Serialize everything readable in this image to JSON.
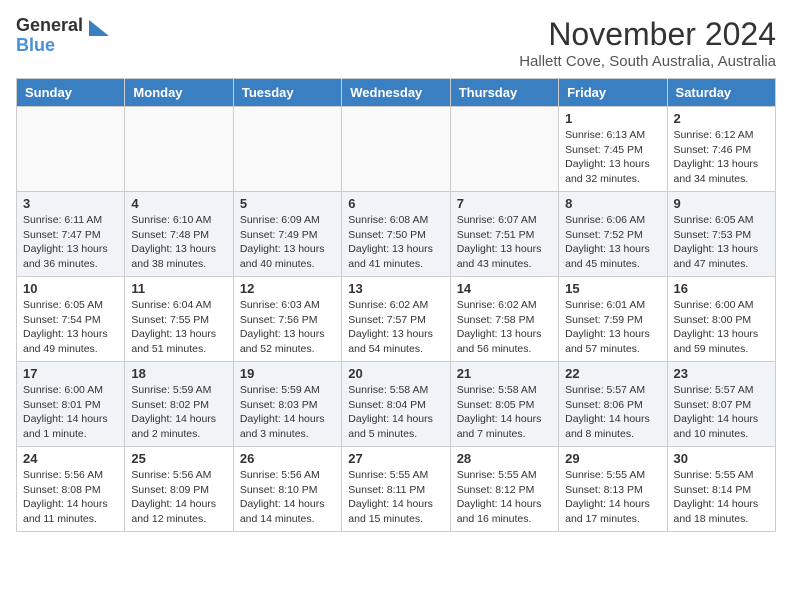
{
  "header": {
    "logo_general": "General",
    "logo_blue": "Blue",
    "month_title": "November 2024",
    "location": "Hallett Cove, South Australia, Australia"
  },
  "weekdays": [
    "Sunday",
    "Monday",
    "Tuesday",
    "Wednesday",
    "Thursday",
    "Friday",
    "Saturday"
  ],
  "weeks": [
    [
      {
        "day": "",
        "empty": true
      },
      {
        "day": "",
        "empty": true
      },
      {
        "day": "",
        "empty": true
      },
      {
        "day": "",
        "empty": true
      },
      {
        "day": "",
        "empty": true
      },
      {
        "day": "1",
        "sunrise": "6:13 AM",
        "sunset": "7:45 PM",
        "daylight": "13 hours and 32 minutes."
      },
      {
        "day": "2",
        "sunrise": "6:12 AM",
        "sunset": "7:46 PM",
        "daylight": "13 hours and 34 minutes."
      }
    ],
    [
      {
        "day": "3",
        "sunrise": "6:11 AM",
        "sunset": "7:47 PM",
        "daylight": "13 hours and 36 minutes."
      },
      {
        "day": "4",
        "sunrise": "6:10 AM",
        "sunset": "7:48 PM",
        "daylight": "13 hours and 38 minutes."
      },
      {
        "day": "5",
        "sunrise": "6:09 AM",
        "sunset": "7:49 PM",
        "daylight": "13 hours and 40 minutes."
      },
      {
        "day": "6",
        "sunrise": "6:08 AM",
        "sunset": "7:50 PM",
        "daylight": "13 hours and 41 minutes."
      },
      {
        "day": "7",
        "sunrise": "6:07 AM",
        "sunset": "7:51 PM",
        "daylight": "13 hours and 43 minutes."
      },
      {
        "day": "8",
        "sunrise": "6:06 AM",
        "sunset": "7:52 PM",
        "daylight": "13 hours and 45 minutes."
      },
      {
        "day": "9",
        "sunrise": "6:05 AM",
        "sunset": "7:53 PM",
        "daylight": "13 hours and 47 minutes."
      }
    ],
    [
      {
        "day": "10",
        "sunrise": "6:05 AM",
        "sunset": "7:54 PM",
        "daylight": "13 hours and 49 minutes."
      },
      {
        "day": "11",
        "sunrise": "6:04 AM",
        "sunset": "7:55 PM",
        "daylight": "13 hours and 51 minutes."
      },
      {
        "day": "12",
        "sunrise": "6:03 AM",
        "sunset": "7:56 PM",
        "daylight": "13 hours and 52 minutes."
      },
      {
        "day": "13",
        "sunrise": "6:02 AM",
        "sunset": "7:57 PM",
        "daylight": "13 hours and 54 minutes."
      },
      {
        "day": "14",
        "sunrise": "6:02 AM",
        "sunset": "7:58 PM",
        "daylight": "13 hours and 56 minutes."
      },
      {
        "day": "15",
        "sunrise": "6:01 AM",
        "sunset": "7:59 PM",
        "daylight": "13 hours and 57 minutes."
      },
      {
        "day": "16",
        "sunrise": "6:00 AM",
        "sunset": "8:00 PM",
        "daylight": "13 hours and 59 minutes."
      }
    ],
    [
      {
        "day": "17",
        "sunrise": "6:00 AM",
        "sunset": "8:01 PM",
        "daylight": "14 hours and 1 minute."
      },
      {
        "day": "18",
        "sunrise": "5:59 AM",
        "sunset": "8:02 PM",
        "daylight": "14 hours and 2 minutes."
      },
      {
        "day": "19",
        "sunrise": "5:59 AM",
        "sunset": "8:03 PM",
        "daylight": "14 hours and 3 minutes."
      },
      {
        "day": "20",
        "sunrise": "5:58 AM",
        "sunset": "8:04 PM",
        "daylight": "14 hours and 5 minutes."
      },
      {
        "day": "21",
        "sunrise": "5:58 AM",
        "sunset": "8:05 PM",
        "daylight": "14 hours and 7 minutes."
      },
      {
        "day": "22",
        "sunrise": "5:57 AM",
        "sunset": "8:06 PM",
        "daylight": "14 hours and 8 minutes."
      },
      {
        "day": "23",
        "sunrise": "5:57 AM",
        "sunset": "8:07 PM",
        "daylight": "14 hours and 10 minutes."
      }
    ],
    [
      {
        "day": "24",
        "sunrise": "5:56 AM",
        "sunset": "8:08 PM",
        "daylight": "14 hours and 11 minutes."
      },
      {
        "day": "25",
        "sunrise": "5:56 AM",
        "sunset": "8:09 PM",
        "daylight": "14 hours and 12 minutes."
      },
      {
        "day": "26",
        "sunrise": "5:56 AM",
        "sunset": "8:10 PM",
        "daylight": "14 hours and 14 minutes."
      },
      {
        "day": "27",
        "sunrise": "5:55 AM",
        "sunset": "8:11 PM",
        "daylight": "14 hours and 15 minutes."
      },
      {
        "day": "28",
        "sunrise": "5:55 AM",
        "sunset": "8:12 PM",
        "daylight": "14 hours and 16 minutes."
      },
      {
        "day": "29",
        "sunrise": "5:55 AM",
        "sunset": "8:13 PM",
        "daylight": "14 hours and 17 minutes."
      },
      {
        "day": "30",
        "sunrise": "5:55 AM",
        "sunset": "8:14 PM",
        "daylight": "14 hours and 18 minutes."
      }
    ]
  ]
}
